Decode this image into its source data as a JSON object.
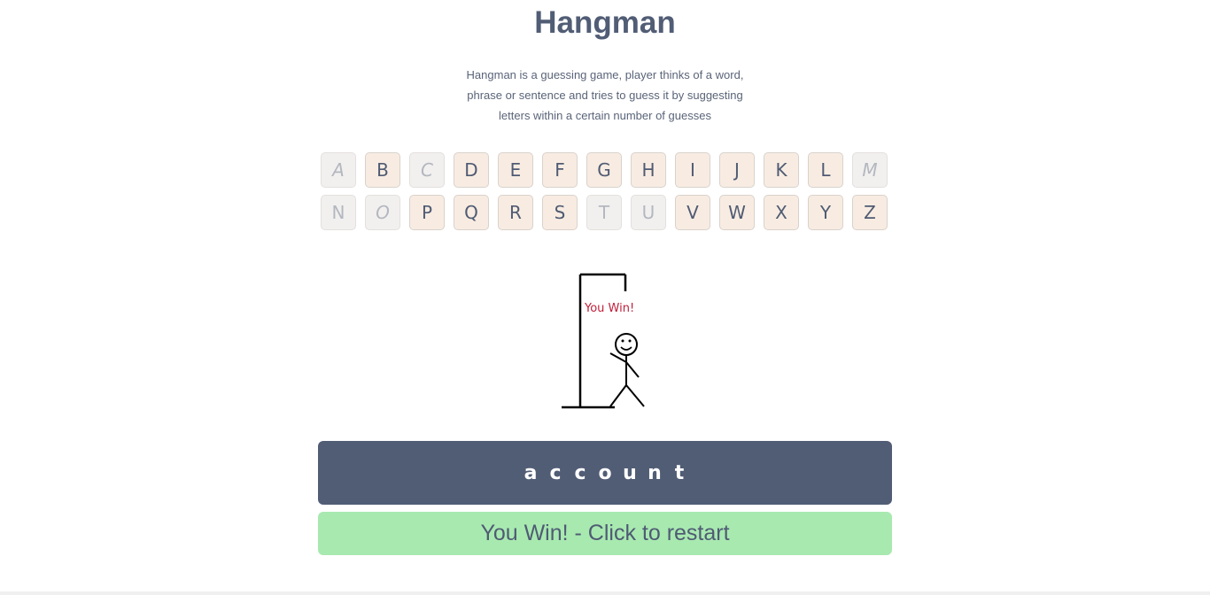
{
  "app": {
    "title": "Hangman",
    "description": "Hangman is a guessing game, player thinks of a word, phrase or sentence and tries to guess it by suggesting letters within a certain number of guesses"
  },
  "keyboard": {
    "rows": [
      [
        {
          "letter": "A",
          "used": true
        },
        {
          "letter": "B",
          "used": false
        },
        {
          "letter": "C",
          "used": true
        },
        {
          "letter": "D",
          "used": false
        },
        {
          "letter": "E",
          "used": false
        },
        {
          "letter": "F",
          "used": false
        },
        {
          "letter": "G",
          "used": false
        },
        {
          "letter": "H",
          "used": false
        },
        {
          "letter": "I",
          "used": false
        },
        {
          "letter": "J",
          "used": false
        },
        {
          "letter": "K",
          "used": false
        },
        {
          "letter": "L",
          "used": false
        },
        {
          "letter": "M",
          "used": true
        }
      ],
      [
        {
          "letter": "N",
          "used": true
        },
        {
          "letter": "O",
          "used": true
        },
        {
          "letter": "P",
          "used": false
        },
        {
          "letter": "Q",
          "used": false
        },
        {
          "letter": "R",
          "used": false
        },
        {
          "letter": "S",
          "used": false
        },
        {
          "letter": "T",
          "used": true
        },
        {
          "letter": "U",
          "used": true
        },
        {
          "letter": "V",
          "used": false
        },
        {
          "letter": "W",
          "used": false
        },
        {
          "letter": "X",
          "used": false
        },
        {
          "letter": "Y",
          "used": false
        },
        {
          "letter": "Z",
          "used": false
        }
      ]
    ]
  },
  "drawing": {
    "message": "You Win!"
  },
  "word": {
    "letters": [
      "a",
      "c",
      "c",
      "o",
      "u",
      "n",
      "t"
    ]
  },
  "restart": {
    "label": "You Win! - Click to restart"
  },
  "colors": {
    "word_bar": "#515d75",
    "restart_bg": "#a8e9b0",
    "key_active": "#f8ece2",
    "key_used": "#f2f0ef",
    "win_text": "#c0203a"
  }
}
